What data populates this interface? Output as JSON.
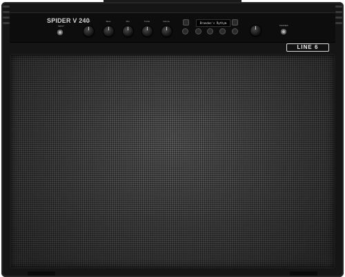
{
  "amp": {
    "model": "SPIDER V 240",
    "display_text": "Brandon's Rythym",
    "brand_logo": "LINE 6",
    "knob_labels": [
      "Gain",
      "Bass",
      "Mid",
      "Treble",
      "Volume"
    ],
    "jack_labels": {
      "input": "INPUT",
      "phones": "PHONES"
    },
    "colors": {
      "body": "#151515",
      "grille": "#3c3c3c",
      "panel": "#0d0d0d",
      "text": "#d8d8d8"
    }
  }
}
